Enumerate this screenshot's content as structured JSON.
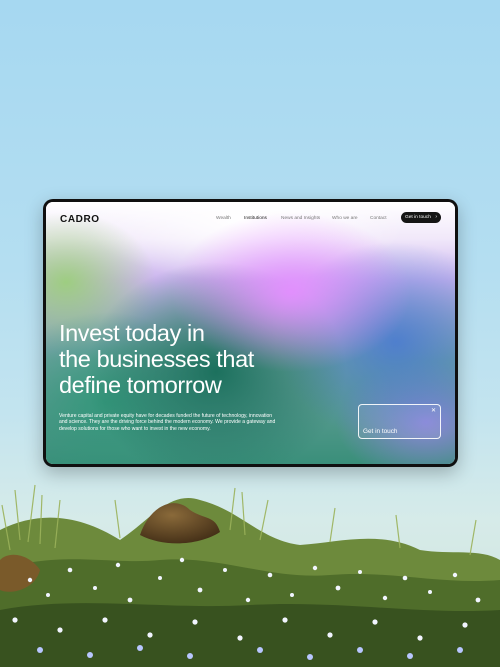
{
  "site": {
    "logo": "CADRO",
    "nav": [
      "Wealth",
      "Institutions",
      "News and Insights",
      "Who we are",
      "Contact"
    ],
    "active_nav": "Institutions",
    "cta_label": "Get in touch",
    "cta_icon": "chevron-right-icon"
  },
  "hero": {
    "headline": [
      "Invest today in",
      "the businesses that",
      "define tomorrow"
    ],
    "description": "Venture capital and private equity have for decades funded the future of technology, innovation and science. They are the driving force behind the modern economy. We provide a gateway and develop solutions for those who want to invest in the new economy."
  },
  "contact_card": {
    "label": "Get in touch",
    "close_icon": "close-icon"
  },
  "colors": {
    "device": "#101010",
    "cta_bg": "#151515",
    "gradient_purple": "#e48eff",
    "gradient_green": "#186e5a",
    "gradient_blue": "#4678d2",
    "sky": "#a6d8f1"
  }
}
